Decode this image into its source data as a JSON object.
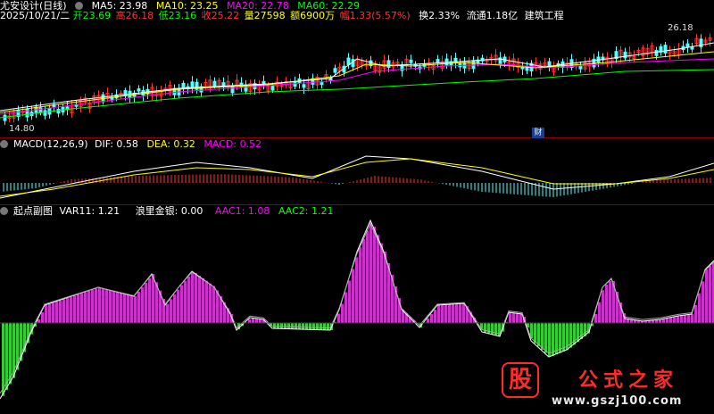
{
  "header": {
    "stock_name": "尤安设计(日线)",
    "ma5": "MA5: 23.98",
    "ma10": "MA10: 23.25",
    "ma20": "MA20: 22.78",
    "ma60": "MA60: 22.29",
    "date": "2025/10/21/二",
    "open": "开23.69",
    "high": "高26.18",
    "low": "低23.16",
    "close": "收25.22",
    "volume": "量27598",
    "amount": "额6900万",
    "change": "幅1.33(5.57%)",
    "turnover": "换2.33%",
    "float": "流通1.18亿",
    "industry": "建筑工程"
  },
  "price_pane": {
    "high_label": "26.18",
    "low_label": "14.80",
    "marker": "财"
  },
  "macd_pane": {
    "title": "MACD(12,26,9)",
    "dif": "DIF: 0.58",
    "dea": "DEA: 0.32",
    "macd": "MACD: 0.52"
  },
  "indicator_pane": {
    "title": "起点副图",
    "var11": "VAR11: 1.21",
    "money": "浪里金银: 0.00",
    "aac1": "AAC1: 1.08",
    "aac2": "AAC2: 1.21"
  },
  "watermark": {
    "badge": "股",
    "title": "公式之家",
    "url": "www.gszj100.com"
  },
  "colors": {
    "up": "#ff3232",
    "down": "#54ffff",
    "ma5": "#ffffff",
    "ma10": "#ffff00",
    "ma20": "#ff00ff",
    "ma60": "#00ff00",
    "positive_bar": "#cc33cc",
    "negative_bar": "#33cc33",
    "separator": "#8b0000"
  }
}
